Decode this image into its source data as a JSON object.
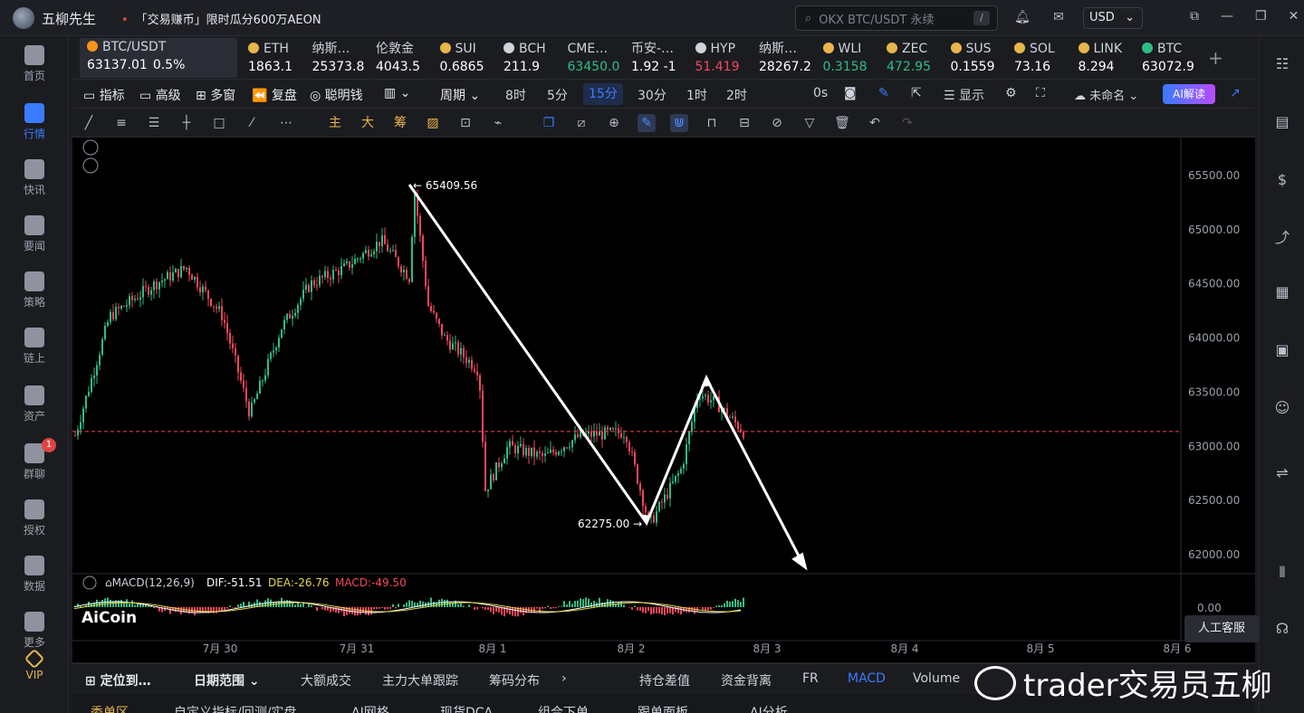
{
  "app": {
    "name": "五柳先生",
    "promo": "「交易赚币」限时瓜分600万AEON"
  },
  "search": {
    "placeholder": "OKX BTC/USDT 永续",
    "shortcut": "/"
  },
  "currency": "USD",
  "left_nav": [
    {
      "label": "首页"
    },
    {
      "label": "行情",
      "active": true
    },
    {
      "label": "快讯"
    },
    {
      "label": "要闻"
    },
    {
      "label": "策略"
    },
    {
      "label": "链上"
    },
    {
      "label": "资产"
    },
    {
      "label": "群聊",
      "badge": "1"
    },
    {
      "label": "授权"
    },
    {
      "label": "数据"
    },
    {
      "label": "更多"
    },
    {
      "label": "VIP"
    }
  ],
  "tickers": [
    {
      "name": "BTC/USDT",
      "price": "63137.01",
      "change": "0.5%",
      "color": "#ffffff",
      "icon_color": "#f7931a"
    },
    {
      "name": "ETH",
      "price": "1863.1",
      "color": "#ffffff",
      "icon_color": "#e8b64a"
    },
    {
      "name": "纳斯…",
      "price": "25373.8",
      "color": "#ffffff"
    },
    {
      "name": "伦敦金",
      "price": "4043.5",
      "color": "#ffffff"
    },
    {
      "name": "SUI",
      "price": "0.6865",
      "color": "#ffffff",
      "icon_color": "#e8b64a"
    },
    {
      "name": "BCH",
      "price": "211.9",
      "color": "#ffffff",
      "icon_color": "#cfd3dc"
    },
    {
      "name": "CME…",
      "price": "63450.0",
      "color": "#2ebd85"
    },
    {
      "name": "币安-…",
      "price": "1.92 -1",
      "color": "#ffffff"
    },
    {
      "name": "HYP",
      "price": "51.419",
      "color": "#f6465d",
      "icon_color": "#cfd3dc"
    },
    {
      "name": "纳斯…",
      "price": "28267.2",
      "color": "#ffffff"
    },
    {
      "name": "WLI",
      "price": "0.3158",
      "color": "#2ebd85",
      "icon_color": "#e8b64a"
    },
    {
      "name": "ZEC",
      "price": "472.95",
      "color": "#2ebd85",
      "icon_color": "#e8b64a"
    },
    {
      "name": "SUS",
      "price": "0.1559",
      "color": "#ffffff",
      "icon_color": "#e8b64a"
    },
    {
      "name": "SOL",
      "price": "73.16",
      "color": "#ffffff",
      "icon_color": "#e8b64a"
    },
    {
      "name": "LINK",
      "price": "8.294",
      "color": "#ffffff",
      "icon_color": "#e8b64a"
    },
    {
      "name": "BTC",
      "price": "63072.9",
      "color": "#ffffff",
      "icon_color": "#2ebd85"
    }
  ],
  "toolbar": {
    "indicators": "指标",
    "advanced": "高级",
    "multi": "多窗",
    "replay": "复盘",
    "smart": "聪明钱",
    "period": "周期",
    "periods": [
      "8时",
      "5分",
      "15分",
      "30分",
      "1时",
      "2时"
    ],
    "selected_period": "15分",
    "countdown": "0s",
    "display": "显示",
    "unnamed": "未命名",
    "ai": "AI解读"
  },
  "drawbar": {
    "labels": [
      "主",
      "大",
      "筹"
    ]
  },
  "chart": {
    "symbol_high": "65409.56",
    "symbol_low": "62275.00",
    "price_axis": [
      "65500.00",
      "65000.00",
      "64500.00",
      "64000.00",
      "63500.00",
      "63000.00",
      "62500.00",
      "62000.00"
    ],
    "macd_axis": "0.00",
    "time_axis": [
      "7月 30",
      "7月 31",
      "8月 1",
      "8月 2",
      "8月 3",
      "8月 4",
      "8月 5",
      "8月 6"
    ],
    "macd_label": "MACD(12,26,9)",
    "dif": "DIF:-51.51",
    "dea": "DEA:-26.76",
    "macd": "MACD:-49.50",
    "current_price": 63137.01,
    "logo": "AiCoin"
  },
  "bottom": {
    "locate": "定位到…",
    "date_range": "日期范围",
    "tabs": [
      "大额成交",
      "主力大单跟踪",
      "筹码分布",
      "持仓差值",
      "资金背离",
      "FR",
      "MACD",
      "Volume"
    ],
    "selected": "MACD"
  },
  "bottom_tabs": [
    "委单区",
    "自定义指标/回测/实盘",
    "AI网格",
    "现货DCA",
    "组合下单",
    "跟单面板",
    "AI分析"
  ],
  "kefu": "人工客服",
  "watermark": "trader交易员五柳"
}
